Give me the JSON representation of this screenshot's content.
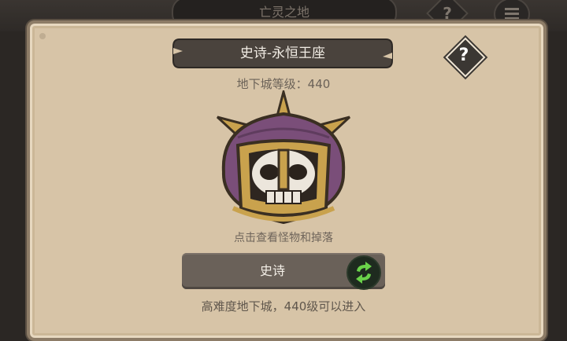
{
  "background": {
    "title": "亡灵之地",
    "help_label": "?",
    "menu_icon": "menu-icon"
  },
  "dialog": {
    "title": "史诗-永恒王座",
    "help_label": "?",
    "level_text": "地下城等级：440",
    "boss_icon": "helmet-skull-icon",
    "view_hint": "点击查看怪物和掉落",
    "difficulty_label": "史诗",
    "switch_icon": "refresh-arrows-icon",
    "footer_note": "高难度地下城，440级可以进入"
  },
  "colors": {
    "parchment": "#d7c4a7",
    "dark_button": "#6a6159",
    "switch_green": "#6ad24a",
    "helmet_purple": "#7a4e79",
    "helmet_gold": "#c9a24d"
  }
}
